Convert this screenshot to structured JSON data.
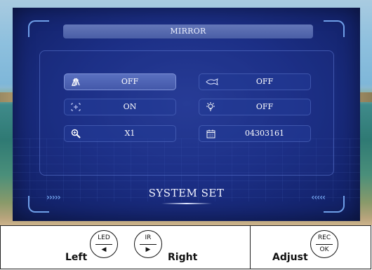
{
  "osd": {
    "title": "MIRROR",
    "footer_title": "SYSTEM SET",
    "nav_left": "›››››",
    "nav_right": "‹‹‹‹‹",
    "items": [
      {
        "icon": "flip-icon",
        "value": "OFF",
        "selected": true
      },
      {
        "icon": "fish-icon",
        "value": "OFF",
        "selected": false
      },
      {
        "icon": "center-cross-icon",
        "value": "ON",
        "selected": false
      },
      {
        "icon": "light-icon",
        "value": "OFF",
        "selected": false
      },
      {
        "icon": "zoom-icon",
        "value": "X1",
        "selected": false
      },
      {
        "icon": "calendar-icon",
        "value": "04303161",
        "selected": false
      }
    ]
  },
  "controls": {
    "left_label": "Left",
    "right_label": "Right",
    "adjust_label": "Adjust",
    "led_button": {
      "top": "LED",
      "bottom": "◀"
    },
    "ir_button": {
      "top": "IR",
      "bottom": "▶"
    },
    "rec_button": {
      "top": "REC",
      "bottom": "OK"
    }
  },
  "colors": {
    "panel": "#1c2f86",
    "accent": "#6f9fe8",
    "selected": "#5a70c0"
  }
}
